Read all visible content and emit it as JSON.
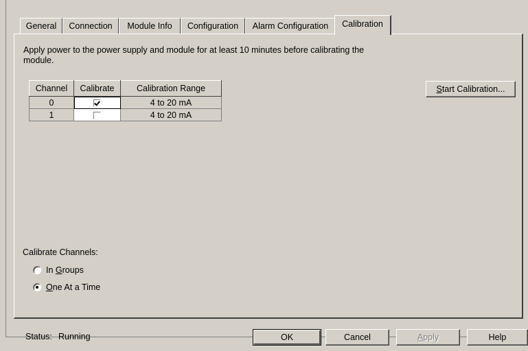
{
  "tabs": [
    {
      "label": "General",
      "active": false
    },
    {
      "label": "Connection",
      "active": false
    },
    {
      "label": "Module Info",
      "active": false
    },
    {
      "label": "Configuration",
      "active": false
    },
    {
      "label": "Alarm Configuration",
      "active": false
    },
    {
      "label": "Calibration",
      "active": true
    }
  ],
  "instructions": "Apply power to the power supply and module for at least 10 minutes before calibrating the module.",
  "grid": {
    "headers": [
      "Channel",
      "Calibrate",
      "Calibration Range"
    ],
    "rows": [
      {
        "channel": "0",
        "calibrate": true,
        "range": "4 to 20 mA"
      },
      {
        "channel": "1",
        "calibrate": false,
        "range": "4 to 20 mA"
      }
    ]
  },
  "start_calibration_button": {
    "label": "Start Calibration...",
    "mnemonic": "S"
  },
  "calibrate_channels": {
    "label": "Calibrate Channels:",
    "options": [
      {
        "label": "In Groups",
        "mnemonic": "G",
        "selected": false
      },
      {
        "label": "One At a Time",
        "mnemonic": "O",
        "selected": true
      }
    ]
  },
  "status": {
    "label": "Status:",
    "value": "Running"
  },
  "footer_buttons": {
    "ok": "OK",
    "cancel": "Cancel",
    "apply": "Apply",
    "help": "Help"
  }
}
